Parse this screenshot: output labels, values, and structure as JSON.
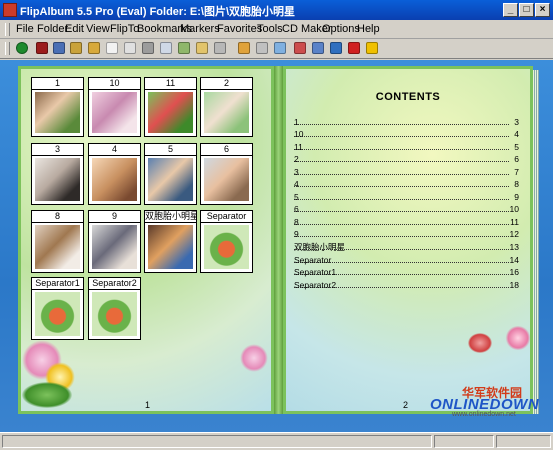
{
  "window": {
    "title": "FlipAlbum 5.5 Pro (Eval)   Folder: E:\\图片\\双胞胎小明星",
    "buttons": {
      "minimize": "_",
      "maximize": "□",
      "close": "×"
    }
  },
  "menu": [
    "File",
    "Folder",
    "Edit",
    "View",
    "FlipTo",
    "Bookmarks",
    "Markers",
    "Favorites",
    "Tools",
    "CD Maker",
    "Options",
    "Help"
  ],
  "toolbar": {
    "icons": [
      "go-icon",
      "book-icon",
      "mail-icon",
      "folder-icon",
      "open-folder-icon",
      "page-icon",
      "pages-icon",
      "print-icon",
      "text-icon",
      "thumb-grid-icon",
      "rotate-icon",
      "frame-icon",
      "music-icon",
      "scissors-icon",
      "grid-icon",
      "image-icon",
      "screen-icon",
      "globe-icon",
      "cursor-icon",
      "help-icon"
    ],
    "colors": [
      "#1e8a2e",
      "#9b1c1c",
      "#4a6fb5",
      "#c9a23a",
      "#d8a93a",
      "#f2f2f2",
      "#e0e0e0",
      "#9c9c9c",
      "#cfd8e6",
      "#8fb76a",
      "#e2c46b",
      "#b7b7b7",
      "#e0a23a",
      "#c0c0c0",
      "#7fb0e0",
      "#cc4d4d",
      "#5a82c8",
      "#2f6fbf",
      "#d02020",
      "#f0c000"
    ]
  },
  "left_page": {
    "thumbnails": [
      {
        "caption": "1"
      },
      {
        "caption": "10"
      },
      {
        "caption": "11"
      },
      {
        "caption": "2"
      },
      {
        "caption": "3"
      },
      {
        "caption": "4"
      },
      {
        "caption": "5"
      },
      {
        "caption": "6"
      },
      {
        "caption": "8"
      },
      {
        "caption": "9"
      },
      {
        "caption": "双胞胎小明星"
      },
      {
        "caption": "Separator"
      },
      {
        "caption": "Separator1"
      },
      {
        "caption": "Separator2"
      }
    ],
    "page_number": "1"
  },
  "right_page": {
    "heading": "CONTENTS",
    "entries": [
      {
        "label": "1",
        "page": "3"
      },
      {
        "label": "10",
        "page": "4"
      },
      {
        "label": "11",
        "page": "5"
      },
      {
        "label": "2",
        "page": "6"
      },
      {
        "label": "3",
        "page": "7"
      },
      {
        "label": "4",
        "page": "8"
      },
      {
        "label": "5",
        "page": "9"
      },
      {
        "label": "6",
        "page": "10"
      },
      {
        "label": "8",
        "page": "11"
      },
      {
        "label": "9",
        "page": "12"
      },
      {
        "label": "双胞胎小明星",
        "page": "13"
      },
      {
        "label": "Separator",
        "page": "14"
      },
      {
        "label": "Separator1",
        "page": "16"
      },
      {
        "label": "Separator2",
        "page": "18"
      }
    ],
    "page_number": "2"
  },
  "watermark": {
    "line1": "华军软件园",
    "line2": "ONLINEDOWN",
    "line3": "www.onlinedown.net"
  }
}
